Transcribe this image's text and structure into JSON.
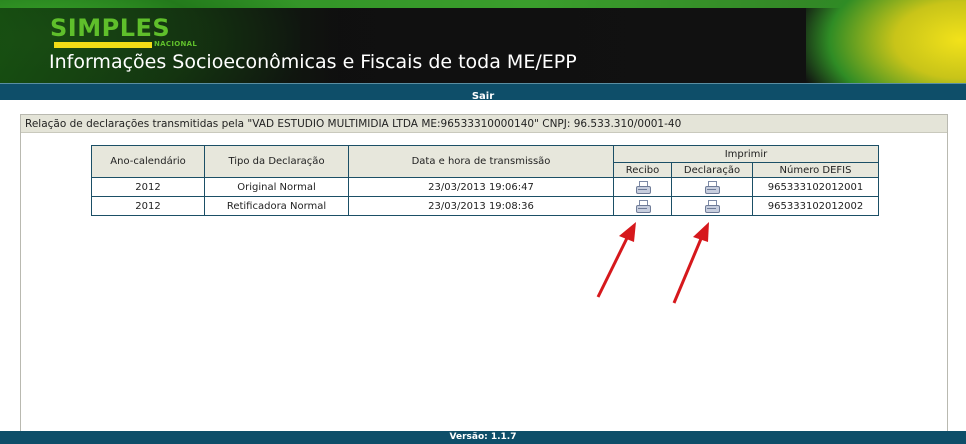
{
  "header": {
    "logo_text": "SIMPLES",
    "logo_sub": "NACIONAL",
    "title": "Informações Socioeconômicas e Fiscais de toda ME/EPP"
  },
  "menu": {
    "sair": "Sair"
  },
  "main": {
    "relation_text": "Relação de declarações transmitidas pela \"VAD ESTUDIO MULTIMIDIA LTDA ME:96533310000140\" CNPJ: 96.533.310/0001-40"
  },
  "table": {
    "headers": {
      "ano": "Ano-calendário",
      "tipo": "Tipo da Declaração",
      "data": "Data e hora de transmissão",
      "imprimir": "Imprimir",
      "recibo": "Recibo",
      "declaracao": "Declaração",
      "defis": "Número DEFIS"
    },
    "rows": [
      {
        "ano": "2012",
        "tipo": "Original Normal",
        "data": "23/03/2013 19:06:47",
        "defis": "965333102012001"
      },
      {
        "ano": "2012",
        "tipo": "Retificadora Normal",
        "data": "23/03/2013 19:08:36",
        "defis": "965333102012002"
      }
    ],
    "icons": {
      "recibo": "printer-icon",
      "declaracao": "printer-icon"
    }
  },
  "footer": {
    "version": "Versão: 1.1.7"
  },
  "colors": {
    "nav_blue": "#0e4e69",
    "table_border": "#1b4f66",
    "header_bg": "#e7e7dc",
    "arrow_red": "#d6181c",
    "brand_green": "#5fbf2b",
    "brand_yellow": "#f2dd16"
  }
}
